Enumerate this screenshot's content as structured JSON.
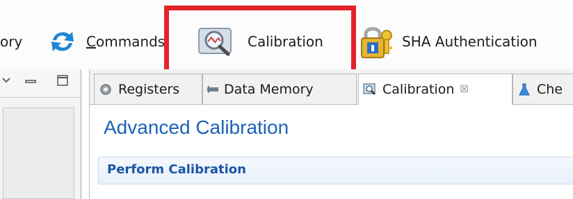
{
  "toolbar": {
    "items": [
      {
        "label": "ory",
        "icon": "memory-icon"
      },
      {
        "label_mnemonic": "C",
        "label_rest": "ommands",
        "icon": "refresh-arrows-icon"
      },
      {
        "label": "Calibration",
        "icon": "magnifier-chart-icon"
      },
      {
        "label": "SHA Authentication",
        "icon": "padlock-key-icon"
      }
    ]
  },
  "left_panel": {
    "icons": [
      "dropdown-icon",
      "minimize-icon",
      "maximize-icon"
    ]
  },
  "editor": {
    "tabs": [
      {
        "label": "Registers",
        "icon": "gear-icon"
      },
      {
        "label": "Data Memory",
        "icon": "memory-chip-icon"
      },
      {
        "label": "Calibration",
        "icon": "magnifier-chart-icon",
        "close": "☒",
        "active": true
      },
      {
        "label": "Che",
        "icon": "flask-icon"
      }
    ],
    "page_title": "Advanced Calibration",
    "section_title": "Perform Calibration"
  },
  "colors": {
    "highlight": "#e3232b",
    "title_blue": "#1b62b8",
    "section_blue": "#1b55a5"
  }
}
